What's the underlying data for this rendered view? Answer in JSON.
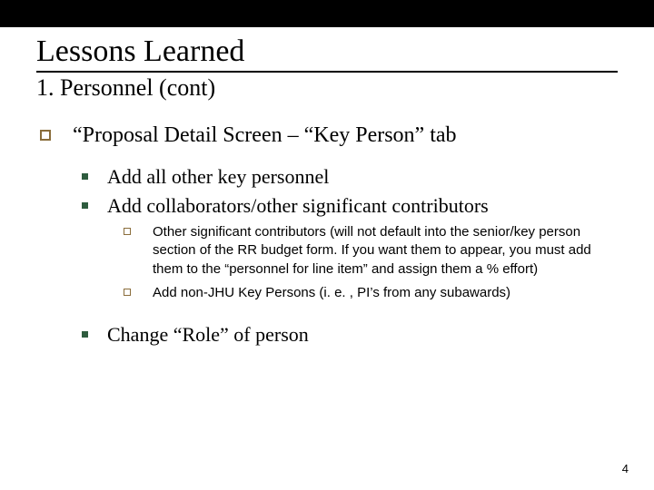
{
  "title": "Lessons Learned",
  "subtitle": "1.  Personnel (cont)",
  "lvl1": {
    "item1": "“Proposal Detail Screen – “Key Person” tab"
  },
  "lvl2": {
    "item1": "Add all other key personnel",
    "item2": "Add collaborators/other significant contributors",
    "item3": "Change “Role” of person"
  },
  "lvl3": {
    "item1": "Other significant contributors (will not default into the senior/key person section of the RR budget form.  If you want them to appear, you must add them to the “personnel for line item” and assign them a % effort)",
    "item2": "Add non-JHU Key Persons (i. e. , PI’s from any subawards)"
  },
  "page_number": "4"
}
